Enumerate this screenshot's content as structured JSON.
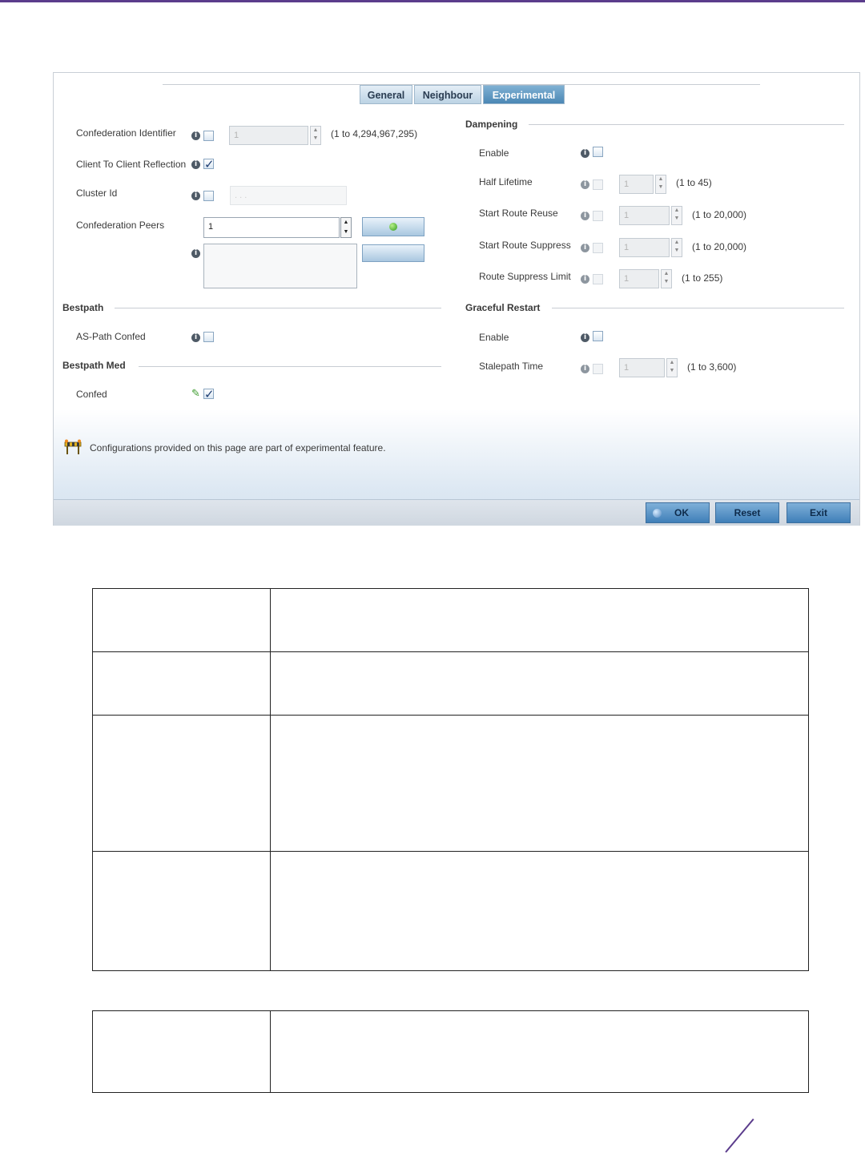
{
  "tabs": [
    {
      "label": "General"
    },
    {
      "label": "Neighbour"
    },
    {
      "label": "Experimental"
    }
  ],
  "left": {
    "confed_id": {
      "label": "Confederation Identifier",
      "value": "1",
      "range": "(1 to 4,294,967,295)"
    },
    "client_reflection": {
      "label": "Client To Client Reflection"
    },
    "cluster_id": {
      "label": "Cluster Id",
      "value": ". . ."
    },
    "confed_peers": {
      "label": "Confederation Peers",
      "value": "1"
    },
    "bestpath": {
      "title": "Bestpath",
      "as_path_confed": "AS-Path Confed"
    },
    "bestpath_med": {
      "title": "Bestpath Med",
      "confed": "Confed"
    }
  },
  "right": {
    "dampening": {
      "title": "Dampening",
      "enable": "Enable",
      "half_lifetime": {
        "label": "Half Lifetime",
        "value": "1",
        "range": "(1 to 45)"
      },
      "start_route_reuse": {
        "label": "Start Route Reuse",
        "value": "1",
        "range": "(1 to 20,000)"
      },
      "start_route_suppress": {
        "label": "Start Route Suppress",
        "value": "1",
        "range": "(1 to 20,000)"
      },
      "route_suppress_limit": {
        "label": "Route Suppress Limit",
        "value": "1",
        "range": "(1 to 255)"
      }
    },
    "graceful_restart": {
      "title": "Graceful Restart",
      "enable": "Enable",
      "stalepath_time": {
        "label": "Stalepath Time",
        "value": "1",
        "range": "(1 to 3,600)"
      }
    }
  },
  "note": "Configurations provided on this page are part of experimental feature.",
  "buttons": {
    "ok": "OK",
    "reset": "Reset",
    "exit": "Exit"
  },
  "colors": {
    "accent": "#5b3c8c",
    "tab_active": "#4b87b5",
    "button": "#3f7fb8"
  }
}
